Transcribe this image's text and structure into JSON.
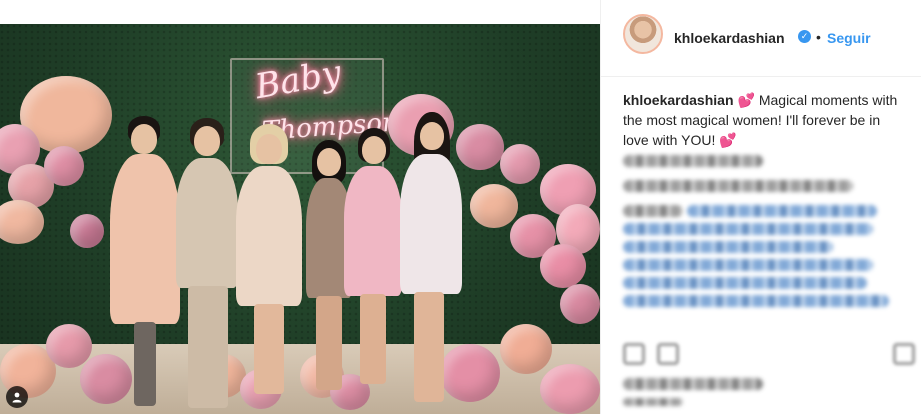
{
  "post": {
    "photo_alt": "",
    "neon_line_1": "Baby",
    "neon_line_2": "Thompson"
  },
  "header": {
    "username": "khloekardashian",
    "verified_icon": "check",
    "separator": "•",
    "follow_label": "Seguir"
  },
  "caption": {
    "username": "khloekardashian",
    "text": "Magical moments with the most magical women! I'll forever be in love with YOU!",
    "emoji": "💕"
  },
  "colors": {
    "accent": "#3897f0",
    "balloon_pink": "#e79aa9",
    "balloon_peach": "#efb49a",
    "wall_green": "#1f3e27"
  }
}
